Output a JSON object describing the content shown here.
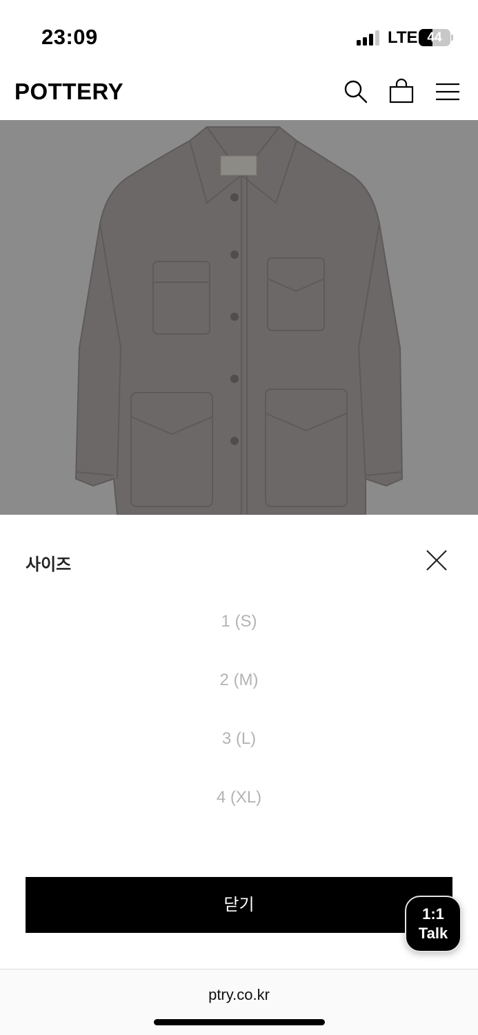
{
  "status_bar": {
    "time": "23:09",
    "network": "LTE",
    "battery_percent": "44",
    "battery_level": 0.44,
    "signal_bars_active": 3
  },
  "header": {
    "logo": "POTTERY",
    "icons": [
      "search-icon",
      "shopping-bag-icon",
      "menu-icon"
    ]
  },
  "product": {
    "image": "jacket-photo",
    "colors": {
      "background": "#efefef",
      "jacket": "#7e7977"
    }
  },
  "size_sheet": {
    "title": "사이즈",
    "close_icon": "close-icon",
    "options": [
      "1 (S)",
      "2 (M)",
      "3 (L)",
      "4 (XL)"
    ],
    "close_button_label": "닫기"
  },
  "talk_button": {
    "line1": "1:1",
    "line2": "Talk"
  },
  "browser": {
    "url": "ptry.co.kr"
  }
}
